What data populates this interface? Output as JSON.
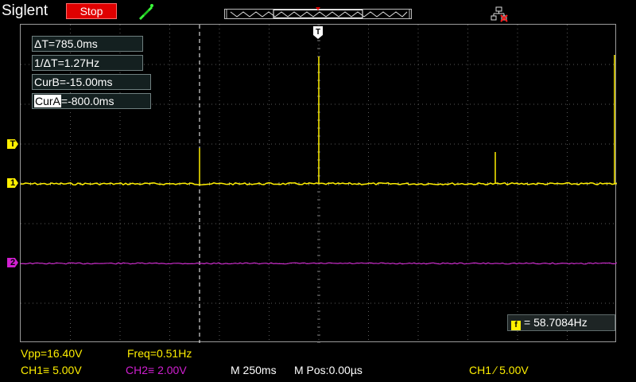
{
  "topbar": {
    "brand": "Siglent",
    "run_state": "Stop"
  },
  "cursors": {
    "delta_t": "ΔT=785.0ms",
    "inv_delta_t": "1/ΔT=1.27Hz",
    "cur_b_label": "CurB",
    "cur_b_value": "=-15.00ms",
    "cur_a_label": "CurA",
    "cur_a_value": "=-800.0ms"
  },
  "trigger_marker": "T",
  "channel_markers": {
    "trigger_level": "T",
    "ch1": "1",
    "ch2": "2"
  },
  "frequency_counter": {
    "icon": "f",
    "value": "= 58.7084Hz"
  },
  "status": {
    "vpp": "Vpp=16.40V",
    "freq": "Freq=0.51Hz",
    "ch1": "CH1≡ 5.00V",
    "ch2": "CH2≡ 2.00V",
    "timebase": "M 250ms",
    "mpos": "M Pos:0.00µs",
    "trigger": "CH1 ∕ 5.00V"
  },
  "colors": {
    "ch1": "#ffef00",
    "ch2": "#d11fd1",
    "stop": "#e00000",
    "grid": "#5a5a5a",
    "cursor": "#ffffff"
  },
  "icons": [
    "probe-icon",
    "network-icon",
    "trigger-position-icon"
  ]
}
